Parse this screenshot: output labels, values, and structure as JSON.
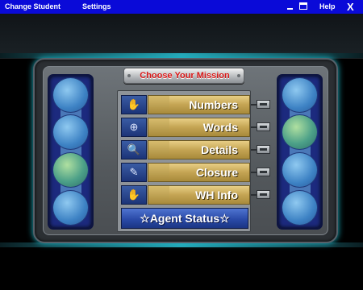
{
  "menubar": {
    "change_student": "Change Student",
    "settings": "Settings",
    "help": "Help",
    "close": "X"
  },
  "title": "Choose Your Mission",
  "missions": [
    {
      "label": "Numbers",
      "icon": "numbers-icon",
      "glyph": "✋"
    },
    {
      "label": "Words",
      "icon": "words-icon",
      "glyph": "⊕"
    },
    {
      "label": "Details",
      "icon": "magnifier-icon",
      "glyph": "🔍"
    },
    {
      "label": "Closure",
      "icon": "closure-icon",
      "glyph": "✎"
    },
    {
      "label": "WH Info",
      "icon": "wh-info-icon",
      "glyph": "✋"
    }
  ],
  "agent_status": "☆Agent Status☆",
  "colors": {
    "menubar": "#0a0ad8",
    "label_gold": "#c4a453",
    "agent_blue": "#2a4aa8",
    "title_red": "#d81818",
    "teal_glow": "#27a7b7"
  }
}
